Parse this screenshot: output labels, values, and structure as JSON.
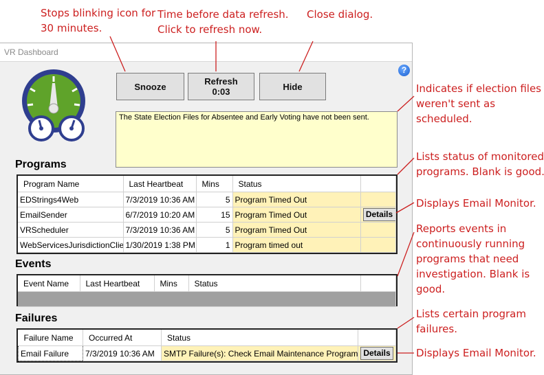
{
  "annotations": {
    "snooze": [
      "Stops blinking icon for",
      "30 minutes."
    ],
    "refresh": [
      "Time before data refresh.",
      "Click to refresh now."
    ],
    "hide": [
      "Close dialog."
    ],
    "message": [
      "Indicates if election files",
      "weren't sent as",
      "scheduled."
    ],
    "programs": [
      "Lists status of monitored",
      "programs. Blank is good."
    ],
    "details1": [
      "Displays Email Monitor."
    ],
    "events": [
      "Reports events in",
      "continuously running",
      "programs that need",
      "investigation. Blank is",
      "good."
    ],
    "failures": [
      "Lists certain program",
      "failures."
    ],
    "details2": [
      "Displays Email Monitor."
    ]
  },
  "window": {
    "title": "VR Dashboard",
    "snooze_label": "Snooze",
    "refresh_label": "Refresh",
    "refresh_time": "0:03",
    "hide_label": "Hide",
    "help_glyph": "?",
    "message": "The State Election Files for Absentee and Early Voting have not been sent."
  },
  "programs": {
    "title": "Programs",
    "headers": [
      "Program Name",
      "Last Heartbeat",
      "Mins",
      "Status",
      ""
    ],
    "rows": [
      {
        "name": "EDStrings4Web",
        "heartbeat": "7/3/2019 10:36 AM",
        "mins": "5",
        "status": "Program Timed Out",
        "action": ""
      },
      {
        "name": "EmailSender",
        "heartbeat": "6/7/2019 10:20 AM",
        "mins": "15",
        "status": "Program Timed Out",
        "action": "Details"
      },
      {
        "name": "VRScheduler",
        "heartbeat": "7/3/2019 10:36 AM",
        "mins": "5",
        "status": "Program Timed Out",
        "action": ""
      },
      {
        "name": "WebServicesJurisdictionClient",
        "heartbeat": "1/30/2019 1:38 PM",
        "mins": "1",
        "status": "Program timed out",
        "action": ""
      }
    ]
  },
  "events": {
    "title": "Events",
    "headers": [
      "Event Name",
      "Last Heartbeat",
      "Mins",
      "Status",
      ""
    ]
  },
  "failures": {
    "title": "Failures",
    "headers": [
      "Failure Name",
      "Occurred At",
      "Status",
      ""
    ],
    "rows": [
      {
        "name": "Email Failure",
        "occurred": "7/3/2019 10:36 AM",
        "status": "SMTP Failure(s): Check Email Maintenance Program",
        "action": "Details"
      }
    ]
  },
  "colors": {
    "annotation": "#cc1f1f",
    "gauge_green": "#5fa32a",
    "gauge_navy": "#2f3e8f",
    "message_bg": "#ffffcc",
    "status_bg": "#fff2b8"
  }
}
